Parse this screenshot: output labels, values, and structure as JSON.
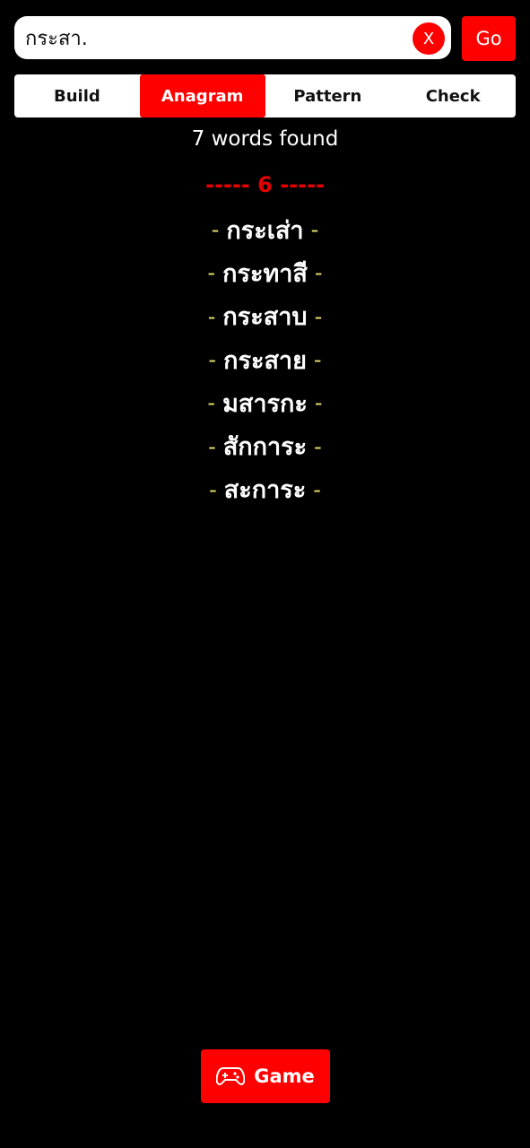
{
  "search": {
    "value": "กระสา.",
    "clear_label": "X",
    "go_label": "Go"
  },
  "tabs": [
    {
      "label": "Build",
      "active": false
    },
    {
      "label": "Anagram",
      "active": true
    },
    {
      "label": "Pattern",
      "active": false
    },
    {
      "label": "Check",
      "active": false
    }
  ],
  "results": {
    "count_text": "7 words found",
    "group_header": "----- 6 -----",
    "words": [
      "กระเส่า",
      "กระทาสี",
      "กระสาบ",
      "กระสาย",
      "มสารกะ",
      "สักการะ",
      "สะการะ"
    ],
    "dash": "-"
  },
  "game_button": {
    "label": "Game",
    "icon": "gamepad-icon"
  },
  "colors": {
    "accent": "#ff0000",
    "background": "#000000",
    "dash": "#e8e070"
  }
}
